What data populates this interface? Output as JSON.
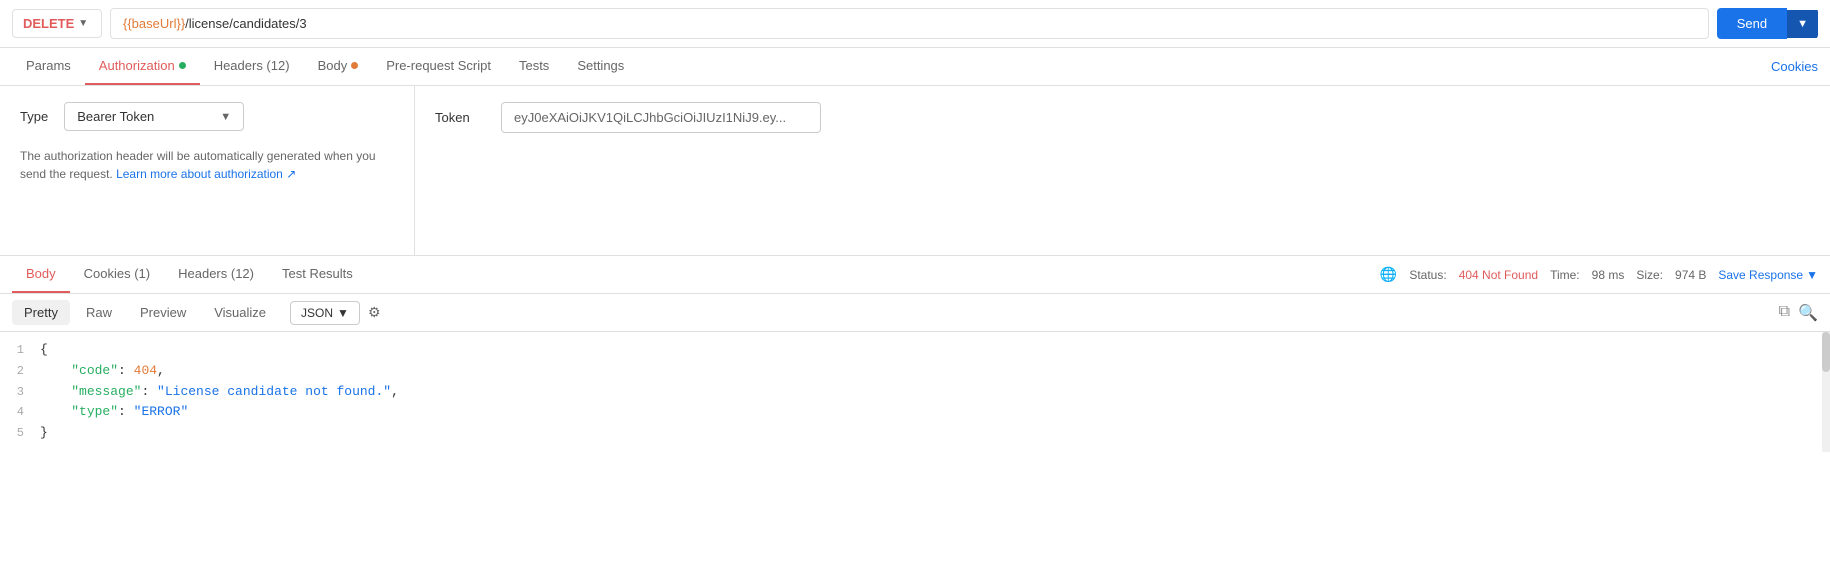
{
  "topbar": {
    "method": "DELETE",
    "url_base": "{{baseUrl}}",
    "url_path": "/license/candidates/3",
    "send_label": "Send"
  },
  "tabs": {
    "items": [
      {
        "id": "params",
        "label": "Params",
        "dot": null,
        "active": false
      },
      {
        "id": "authorization",
        "label": "Authorization",
        "dot": "green",
        "active": true
      },
      {
        "id": "headers",
        "label": "Headers (12)",
        "dot": null,
        "active": false
      },
      {
        "id": "body",
        "label": "Body",
        "dot": "orange",
        "active": false
      },
      {
        "id": "prerequest",
        "label": "Pre-request Script",
        "dot": null,
        "active": false
      },
      {
        "id": "tests",
        "label": "Tests",
        "dot": null,
        "active": false
      },
      {
        "id": "settings",
        "label": "Settings",
        "dot": null,
        "active": false
      }
    ],
    "cookies_label": "Cookies"
  },
  "auth": {
    "type_label": "Type",
    "type_value": "Bearer Token",
    "note_text": "The authorization header will be automatically generated when you send the request.",
    "note_link": "Learn more about authorization ↗",
    "token_label": "Token",
    "token_value": "eyJ0eXAiOiJKV1QiLCJhbGciOiJIUzI1NiJ9.ey..."
  },
  "response": {
    "tabs": [
      {
        "id": "body",
        "label": "Body",
        "active": true
      },
      {
        "id": "cookies",
        "label": "Cookies (1)",
        "active": false
      },
      {
        "id": "headers",
        "label": "Headers (12)",
        "active": false
      },
      {
        "id": "test_results",
        "label": "Test Results",
        "active": false
      }
    ],
    "status_label": "Status:",
    "status_code": "404 Not Found",
    "time_label": "Time:",
    "time_value": "98 ms",
    "size_label": "Size:",
    "size_value": "974 B",
    "save_response": "Save Response"
  },
  "body_toolbar": {
    "tabs": [
      "Pretty",
      "Raw",
      "Preview",
      "Visualize"
    ],
    "active_tab": "Pretty",
    "format": "JSON"
  },
  "code": {
    "lines": [
      {
        "num": 1,
        "content": "{"
      },
      {
        "num": 2,
        "content": "  \"code\": 404,"
      },
      {
        "num": 3,
        "content": "  \"message\": \"License candidate not found.\","
      },
      {
        "num": 4,
        "content": "  \"type\": \"ERROR\""
      },
      {
        "num": 5,
        "content": "}"
      }
    ]
  }
}
